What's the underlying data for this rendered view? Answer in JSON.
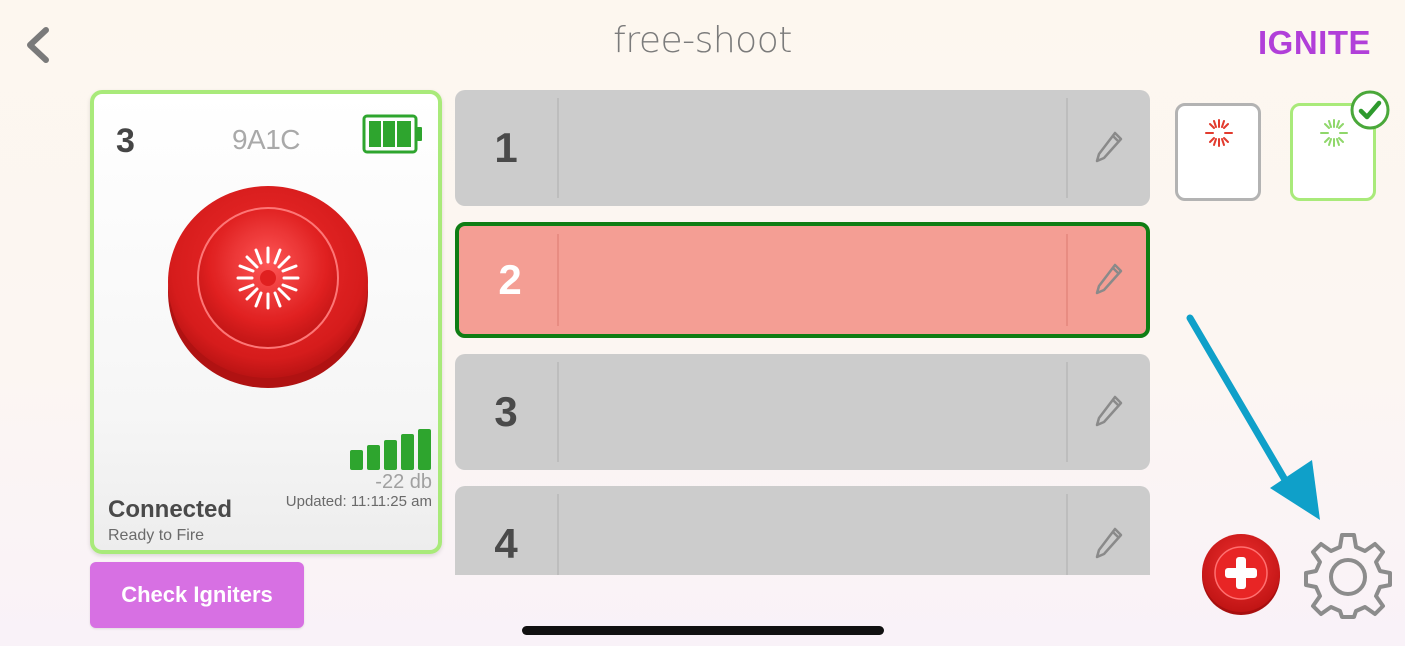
{
  "header": {
    "title": "free-shoot",
    "brand": "IGNITE",
    "back_icon": "chevron-left-icon"
  },
  "device": {
    "number": "3",
    "id": "9A1C",
    "battery_icon": "battery-full-icon",
    "signal_icon": "signal-bars-icon",
    "signal_db": "-22 db",
    "updated": "Updated: 11:11:25 am",
    "status": "Connected",
    "status_detail": "Ready to Fire"
  },
  "actions": {
    "check_igniters_label": "Check Igniters"
  },
  "cues": [
    {
      "number": "1",
      "selected": false
    },
    {
      "number": "2",
      "selected": true
    },
    {
      "number": "3",
      "selected": false
    },
    {
      "number": "4",
      "selected": false
    }
  ],
  "thumbnails": [
    {
      "icon": "burst-icon",
      "color": "#e23b2e",
      "selected": false
    },
    {
      "icon": "burst-icon",
      "color": "#8fd76a",
      "selected": true
    }
  ],
  "colors": {
    "accent_green": "#0f7d14",
    "card_border": "#a9ea7a",
    "selected_row": "#f49e94",
    "button_purple": "#d770e3",
    "brand_purple": "#b13fd9",
    "arrow_blue": "#0fa0c9",
    "fire_red": "#d81e1e"
  }
}
